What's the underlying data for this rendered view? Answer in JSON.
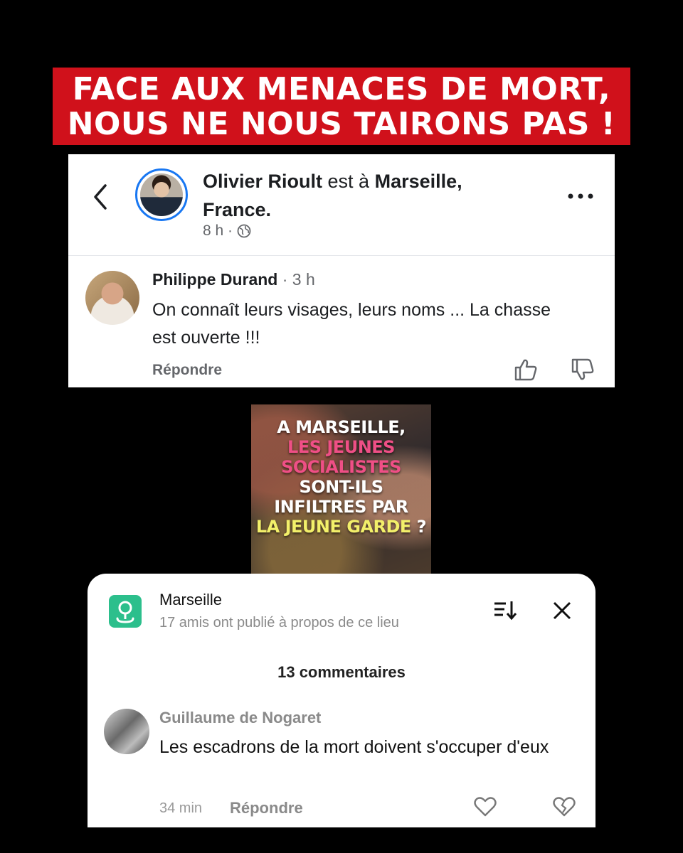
{
  "headline": {
    "line1": "FACE AUX MENACES DE MORT,",
    "line2": "NOUS NE NOUS TAIRONS PAS !",
    "color": "#d0111b"
  },
  "facebook_post": {
    "author": "Olivier Rioult",
    "location_prefix": " est à ",
    "location": "Marseille, France.",
    "time": "8 h ·",
    "icons": [
      "back-icon",
      "globe-icon",
      "more-icon"
    ],
    "comment": {
      "author": "Philippe Durand",
      "time": " · 3 h",
      "text": "On connaît leurs visages, leurs noms ... La chasse est ouverte !!!",
      "reply_label": "Répondre",
      "icons": [
        "thumbs-up-icon",
        "thumbs-down-icon"
      ]
    }
  },
  "video_thumbnail": {
    "line1": "A MARSEILLE,",
    "line2": "LES JEUNES",
    "line3": "SOCIALISTES",
    "line4": "SONT-ILS",
    "line5": "INFILTRES PAR",
    "line6": "LA JEUNE GARDE",
    "line6_suffix": " ?"
  },
  "place_comments": {
    "place": "Marseille",
    "subtitle": "17 amis ont publié à propos de ce lieu",
    "count_label": "13 commentaires",
    "icons": [
      "location-pin-icon",
      "sort-icon",
      "close-icon"
    ],
    "accent": "#2cbf8c",
    "comment": {
      "author": "Guillaume de Nogaret",
      "text": "Les escadrons de la mort doivent s'occuper d'eux",
      "time": "34 min",
      "reply_label": "Répondre",
      "icons": [
        "heart-icon",
        "broken-heart-icon"
      ]
    }
  }
}
